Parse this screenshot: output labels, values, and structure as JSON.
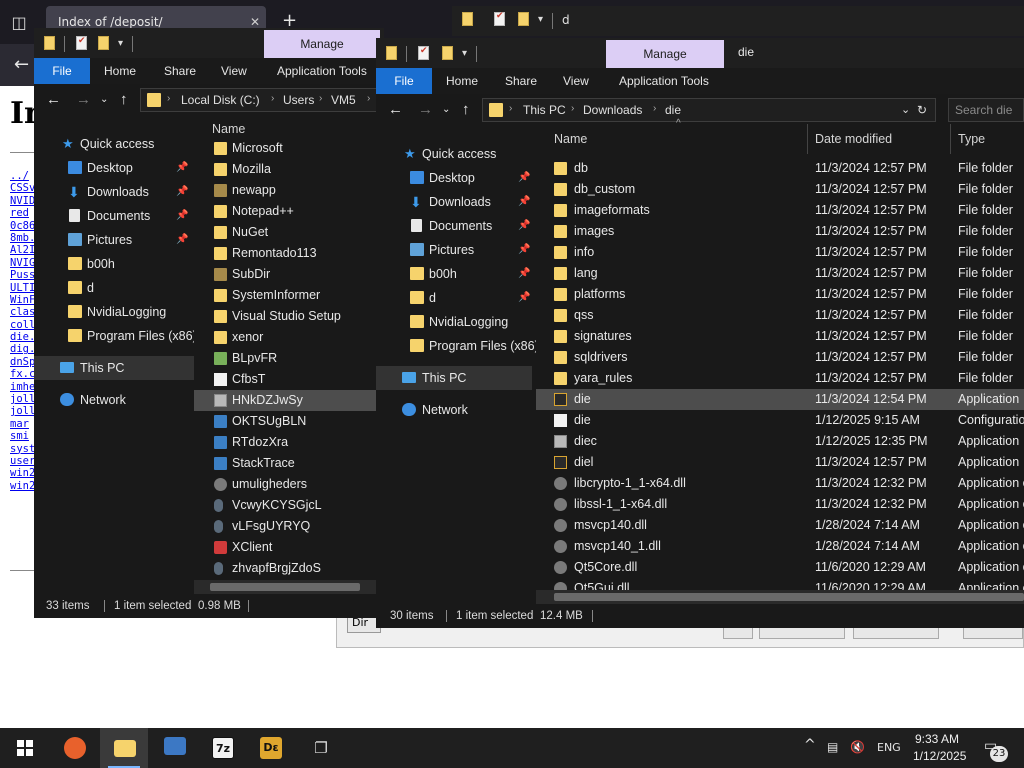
{
  "browser": {
    "tab_title": "Index of /deposit/",
    "tab_close": "✕",
    "new_tab": "+",
    "back": "←",
    "page_heading": "In",
    "links": [
      "../",
      "CSSv",
      "NVID",
      "red",
      "0c86",
      "8mb.",
      "Al2I",
      "NVIG",
      "Puss",
      "ULTI",
      "WinF",
      "clas",
      "coll",
      "die.",
      "dig.",
      "dnSp",
      "fx.c",
      "imhe",
      "joll",
      "joll",
      "mar",
      "smi",
      "syst",
      "user",
      "win2",
      "win2"
    ],
    "dialog_button": "Dir"
  },
  "bg_explorer": {
    "title": "d"
  },
  "explorer_left": {
    "manage_label": "Manage",
    "ribbon": [
      "File",
      "Home",
      "Share",
      "View",
      "Application Tools"
    ],
    "breadcrumb": [
      "Local Disk (C:)",
      "Users",
      "VM5"
    ],
    "nav": {
      "quick_access": "Quick access",
      "items": [
        "Desktop",
        "Downloads",
        "Documents",
        "Pictures",
        "b00h",
        "d",
        "NvidiaLogging",
        "Program Files (x86)"
      ],
      "this_pc": "This PC",
      "network": "Network"
    },
    "column_name": "Name",
    "files": [
      "Microsoft",
      "Mozilla",
      "newapp",
      "Notepad++",
      "NuGet",
      "Remontado113",
      "SubDir",
      "SystemInformer",
      "Visual Studio Setup",
      "xenor",
      "BLpvFR",
      "CfbsT",
      "HNkDZJwSy",
      "OKTSUgBLN",
      "RTdozXra",
      "StackTrace",
      "umuligheders",
      "VcwyKCYSGjcL",
      "vLFsgUYRYQ",
      "XClient",
      "zhvapfBrgjZdoS"
    ],
    "status": {
      "count": "33 items",
      "selected": "1 item selected",
      "size": "0.98 MB"
    }
  },
  "explorer_right": {
    "manage_label": "Manage",
    "title": "die",
    "ribbon": [
      "File",
      "Home",
      "Share",
      "View",
      "Application Tools"
    ],
    "breadcrumb": [
      "This PC",
      "Downloads",
      "die"
    ],
    "search_placeholder": "Search die",
    "nav": {
      "quick_access": "Quick access",
      "items": [
        "Desktop",
        "Downloads",
        "Documents",
        "Pictures",
        "b00h",
        "d",
        "NvidiaLogging",
        "Program Files (x86)"
      ],
      "this_pc": "This PC",
      "network": "Network"
    },
    "columns": {
      "name": "Name",
      "date": "Date modified",
      "type": "Type"
    },
    "rows": [
      {
        "name": "db",
        "date": "11/3/2024 12:57 PM",
        "type": "File folder"
      },
      {
        "name": "db_custom",
        "date": "11/3/2024 12:57 PM",
        "type": "File folder"
      },
      {
        "name": "imageformats",
        "date": "11/3/2024 12:57 PM",
        "type": "File folder"
      },
      {
        "name": "images",
        "date": "11/3/2024 12:57 PM",
        "type": "File folder"
      },
      {
        "name": "info",
        "date": "11/3/2024 12:57 PM",
        "type": "File folder"
      },
      {
        "name": "lang",
        "date": "11/3/2024 12:57 PM",
        "type": "File folder"
      },
      {
        "name": "platforms",
        "date": "11/3/2024 12:57 PM",
        "type": "File folder"
      },
      {
        "name": "qss",
        "date": "11/3/2024 12:57 PM",
        "type": "File folder"
      },
      {
        "name": "signatures",
        "date": "11/3/2024 12:57 PM",
        "type": "File folder"
      },
      {
        "name": "sqldrivers",
        "date": "11/3/2024 12:57 PM",
        "type": "File folder"
      },
      {
        "name": "yara_rules",
        "date": "11/3/2024 12:57 PM",
        "type": "File folder"
      },
      {
        "name": "die",
        "date": "11/3/2024 12:54 PM",
        "type": "Application"
      },
      {
        "name": "die",
        "date": "1/12/2025 9:15 AM",
        "type": "Configuration"
      },
      {
        "name": "diec",
        "date": "1/12/2025 12:35 PM",
        "type": "Application"
      },
      {
        "name": "diel",
        "date": "11/3/2024 12:57 PM",
        "type": "Application"
      },
      {
        "name": "libcrypto-1_1-x64.dll",
        "date": "11/3/2024 12:32 PM",
        "type": "Application e"
      },
      {
        "name": "libssl-1_1-x64.dll",
        "date": "11/3/2024 12:32 PM",
        "type": "Application e"
      },
      {
        "name": "msvcp140.dll",
        "date": "1/28/2024 7:14 AM",
        "type": "Application e"
      },
      {
        "name": "msvcp140_1.dll",
        "date": "1/28/2024 7:14 AM",
        "type": "Application e"
      },
      {
        "name": "Qt5Core.dll",
        "date": "11/6/2020 12:29 AM",
        "type": "Application e"
      },
      {
        "name": "Qt5Gui.dll",
        "date": "11/6/2020 12:29 AM",
        "type": "Application e"
      }
    ],
    "status": {
      "count": "30 items",
      "selected": "1 item selected",
      "size": "12.4 MB"
    }
  },
  "taskbar": {
    "sevenzip": "7z",
    "die_app": "Dε",
    "lang": "ENG",
    "time": "9:33 AM",
    "date": "1/12/2025",
    "notifications": "23"
  },
  "colors": {
    "accent": "#1a6fd1",
    "manage": "#dccef5",
    "folder": "#f6d36c",
    "bg_dark": "#191919"
  }
}
